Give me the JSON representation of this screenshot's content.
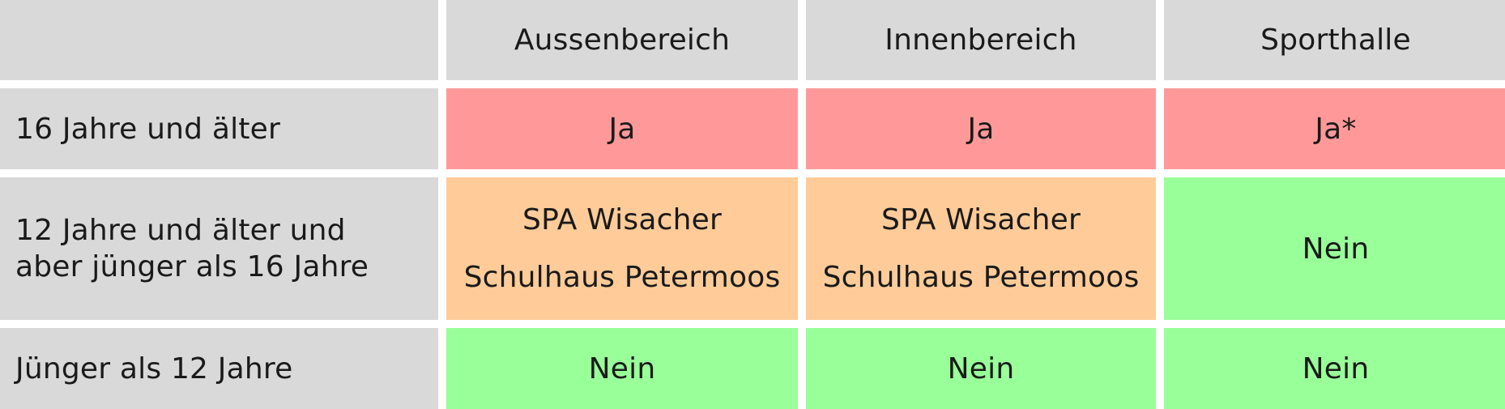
{
  "table": {
    "corner": "",
    "headers": [
      "Aussenbereich",
      "Innenbereich",
      "Sporthalle"
    ],
    "rows": [
      {
        "label": [
          "16 Jahre und älter"
        ],
        "cells": [
          {
            "lines": [
              "Ja"
            ],
            "color": "#ff9999"
          },
          {
            "lines": [
              "Ja"
            ],
            "color": "#ff9999"
          },
          {
            "lines": [
              "Ja*"
            ],
            "color": "#ff9999"
          }
        ]
      },
      {
        "label": [
          "12 Jahre und älter und",
          "aber jünger als 16 Jahre"
        ],
        "cells": [
          {
            "lines": [
              "SPA Wisacher",
              "Schulhaus Petermoos"
            ],
            "color": "#ffcc99"
          },
          {
            "lines": [
              "SPA Wisacher",
              "Schulhaus Petermoos"
            ],
            "color": "#ffcc99"
          },
          {
            "lines": [
              "Nein"
            ],
            "color": "#99ff99"
          }
        ]
      },
      {
        "label": [
          "Jünger als 12 Jahre"
        ],
        "cells": [
          {
            "lines": [
              "Nein"
            ],
            "color": "#99ff99"
          },
          {
            "lines": [
              "Nein"
            ],
            "color": "#99ff99"
          },
          {
            "lines": [
              "Nein"
            ],
            "color": "#99ff99"
          }
        ]
      }
    ],
    "colors": {
      "header_bg": "#d9d9d9",
      "yes": "#ff9999",
      "partial": "#ffcc99",
      "no": "#99ff99",
      "divider": "#ffffff"
    }
  }
}
